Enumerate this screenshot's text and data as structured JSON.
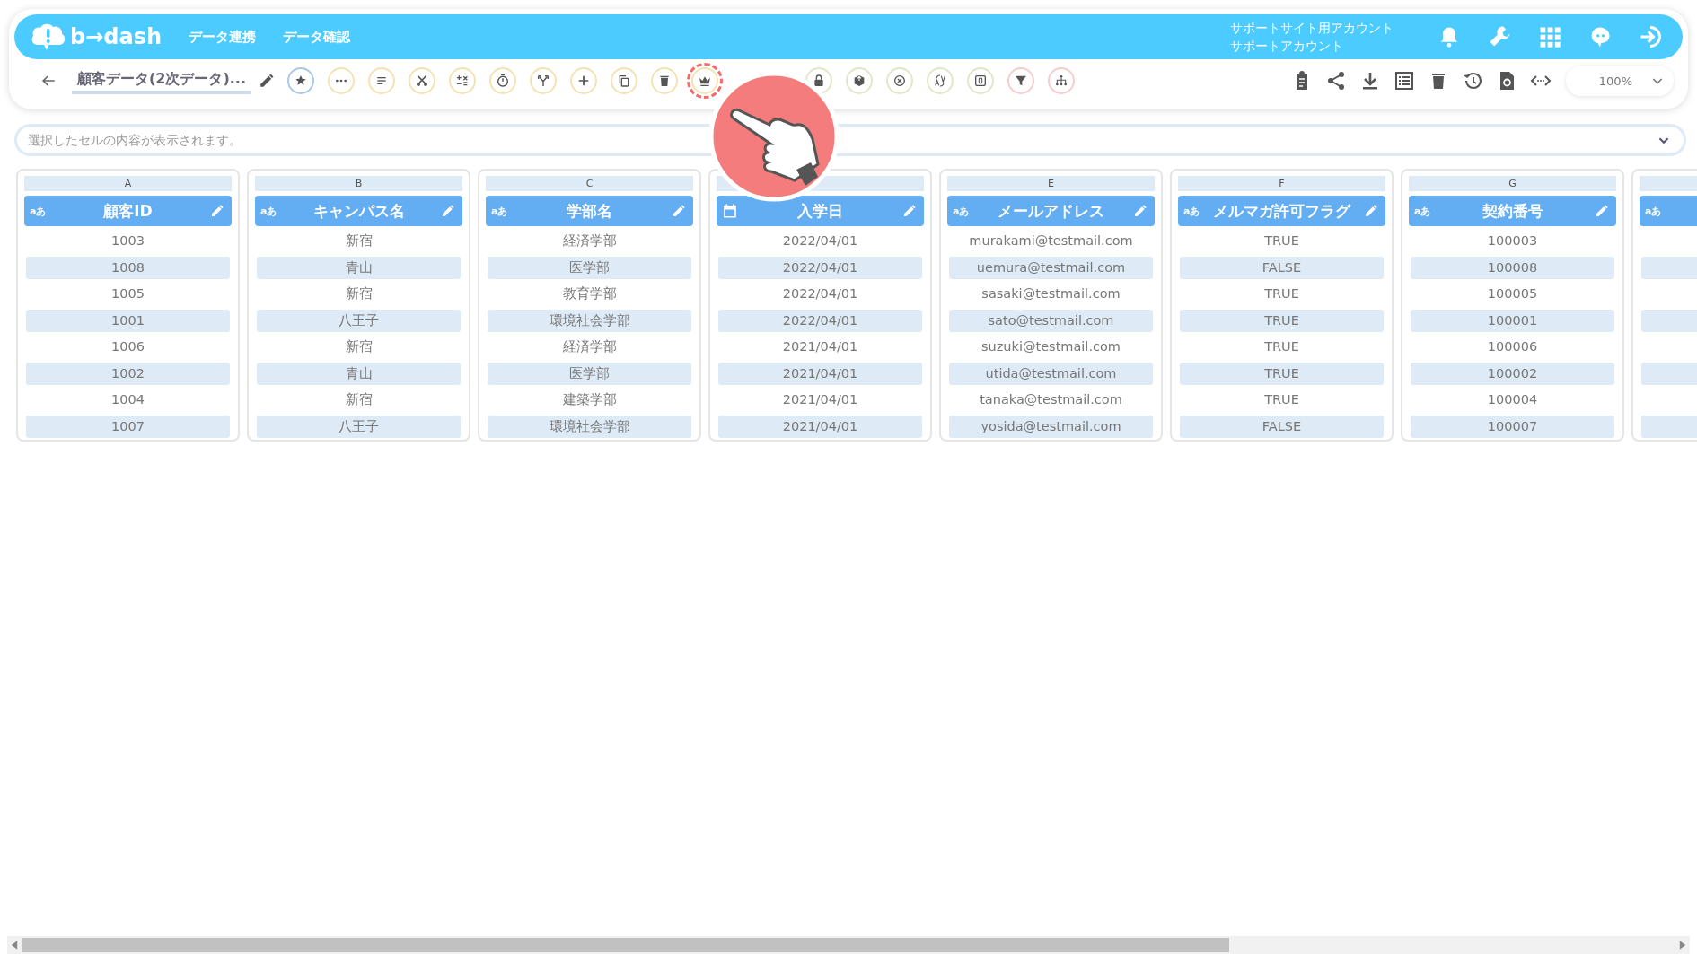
{
  "navbar": {
    "logo": "b→dash",
    "menu": [
      "データ連携",
      "データ確認"
    ],
    "account": [
      "サポートサイト用アカウント",
      "サポートアカウント"
    ],
    "icons": [
      {
        "kind": "bell"
      },
      {
        "kind": "wrench"
      },
      {
        "kind": "grid"
      },
      {
        "kind": "chat"
      },
      {
        "kind": "logout"
      }
    ]
  },
  "toolbar": {
    "title": "顧客データ(2次データ)...",
    "tools": [
      {
        "kind": "star",
        "color": "#a9c8e8",
        "highlighted": false
      },
      {
        "kind": "dots",
        "color": "#f3e3b3",
        "highlighted": false
      },
      {
        "kind": "lines",
        "color": "#f3e3b3",
        "highlighted": false
      },
      {
        "kind": "scissors",
        "color": "#f3e3b3",
        "highlighted": false
      },
      {
        "kind": "calc",
        "color": "#f3e3b3",
        "highlighted": false
      },
      {
        "kind": "timer",
        "color": "#f3e3b3",
        "highlighted": false
      },
      {
        "kind": "branch",
        "color": "#f3e3b3",
        "highlighted": false
      },
      {
        "kind": "plus",
        "color": "#f3e3b3",
        "highlighted": false
      },
      {
        "kind": "copy",
        "color": "#f3e3b3",
        "highlighted": false
      },
      {
        "kind": "trash",
        "color": "#f3e3b3",
        "highlighted": false
      },
      {
        "kind": "crown",
        "color": "#f3e3b3",
        "highlighted": true
      },
      {
        "kind": "lock",
        "color": "#dfe8c8",
        "highlighted": false
      },
      {
        "kind": "box",
        "color": "#dfe8c8",
        "highlighted": false
      },
      {
        "kind": "xcircle",
        "color": "#dfe8c8",
        "highlighted": false
      },
      {
        "kind": "translate",
        "color": "#dfe8c8",
        "highlighted": false
      },
      {
        "kind": "zero",
        "color": "#dfe8c8",
        "highlighted": false
      },
      {
        "kind": "filter",
        "color": "#f8cccc",
        "highlighted": false
      },
      {
        "kind": "network",
        "color": "#f8cccc",
        "highlighted": false
      }
    ],
    "actions": [
      {
        "kind": "clipboard"
      },
      {
        "kind": "share"
      },
      {
        "kind": "download"
      },
      {
        "kind": "list"
      },
      {
        "kind": "trash"
      },
      {
        "kind": "history"
      },
      {
        "kind": "refresh"
      },
      {
        "kind": "code"
      }
    ],
    "zoom": "100%"
  },
  "formula_bar": {
    "placeholder": "選択したセルの内容が表示されます。"
  },
  "columns": [
    {
      "letter": "A",
      "kind": "text",
      "type_label": "aあ",
      "name": "顧客ID",
      "cells": [
        "1003",
        "1008",
        "1005",
        "1001",
        "1006",
        "1002",
        "1004",
        "1007"
      ]
    },
    {
      "letter": "B",
      "kind": "text",
      "type_label": "aあ",
      "name": "キャンパス名",
      "cells": [
        "新宿",
        "青山",
        "新宿",
        "八王子",
        "新宿",
        "青山",
        "新宿",
        "八王子"
      ]
    },
    {
      "letter": "C",
      "kind": "text",
      "type_label": "aあ",
      "name": "学部名",
      "cells": [
        "経済学部",
        "医学部",
        "教育学部",
        "環境社会学部",
        "経済学部",
        "医学部",
        "建築学部",
        "環境社会学部"
      ]
    },
    {
      "kind": "date",
      "name": "入学日",
      "cells": [
        "2022/04/01",
        "2022/04/01",
        "2022/04/01",
        "2022/04/01",
        "2021/04/01",
        "2021/04/01",
        "2021/04/01",
        "2021/04/01"
      ]
    },
    {
      "letter": "E",
      "kind": "text",
      "type_label": "aあ",
      "name": "メールアドレス",
      "cells": [
        "murakami@testmail.com",
        "uemura@testmail.com",
        "sasaki@testmail.com",
        "sato@testmail.com",
        "suzuki@testmail.com",
        "utida@testmail.com",
        "tanaka@testmail.com",
        "yosida@testmail.com"
      ]
    },
    {
      "letter": "F",
      "kind": "text",
      "type_label": "aあ",
      "name": "メルマガ許可フラグ",
      "cells": [
        "TRUE",
        "FALSE",
        "TRUE",
        "TRUE",
        "TRUE",
        "TRUE",
        "TRUE",
        "FALSE"
      ]
    },
    {
      "letter": "G",
      "kind": "text",
      "type_label": "aあ",
      "name": "契約番号",
      "cells": [
        "100003",
        "100008",
        "100005",
        "100001",
        "100006",
        "100002",
        "100004",
        "100007"
      ]
    },
    {
      "kind": "text",
      "type_label": "aあ"
    }
  ]
}
